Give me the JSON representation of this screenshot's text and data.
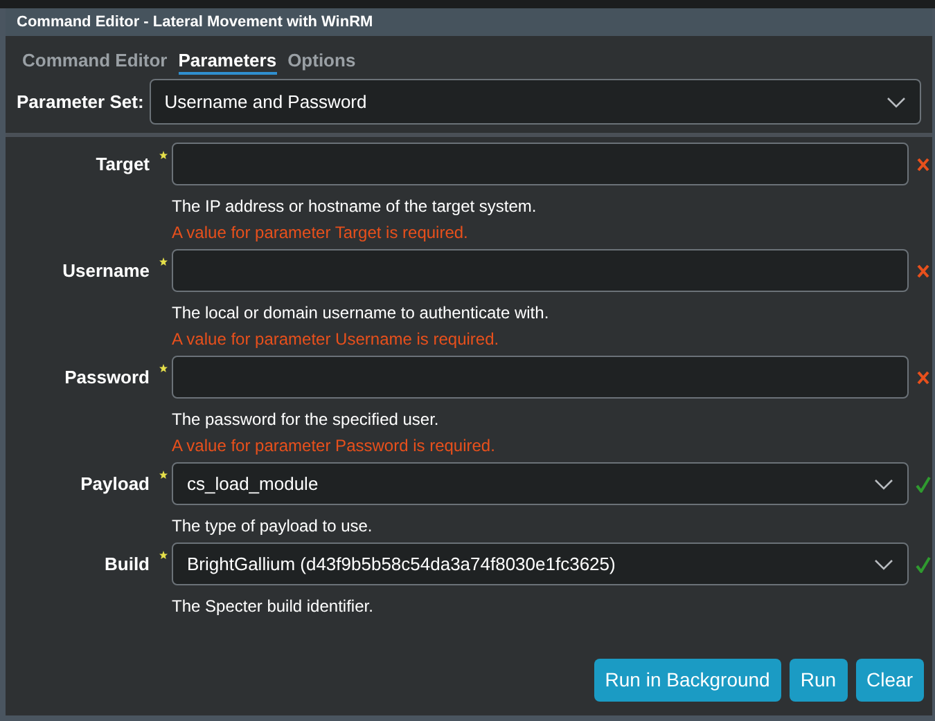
{
  "window": {
    "title": "Command Editor - Lateral Movement with WinRM"
  },
  "tabs": [
    {
      "label": "Command Editor",
      "selected": false
    },
    {
      "label": "Parameters",
      "selected": true
    },
    {
      "label": "Options",
      "selected": false
    }
  ],
  "parameter_set": {
    "label": "Parameter Set:",
    "value": "Username and Password"
  },
  "fields": [
    {
      "label": "Target",
      "required": true,
      "kind": "text",
      "valid": false,
      "description": "The IP address or hostname of the target system.",
      "error": "A value for parameter Target is required."
    },
    {
      "label": "Username",
      "required": true,
      "kind": "text",
      "valid": false,
      "description": "The local or domain username to authenticate with.",
      "error": "A value for parameter Username is required."
    },
    {
      "label": "Password",
      "required": true,
      "kind": "text",
      "valid": false,
      "description": "The password for the specified user.",
      "error": "A value for parameter Password is required."
    },
    {
      "label": "Payload",
      "required": true,
      "kind": "select",
      "value": "cs_load_module",
      "valid": true,
      "description": "The type of payload to use."
    },
    {
      "label": "Build",
      "required": true,
      "kind": "select",
      "value": "BrightGallium (d43f9b5b58c54da3a74f8030e1fc3625)",
      "valid": true,
      "description": "The Specter build identifier."
    }
  ],
  "buttons": [
    "Run in Background",
    "Run",
    "Clear"
  ]
}
